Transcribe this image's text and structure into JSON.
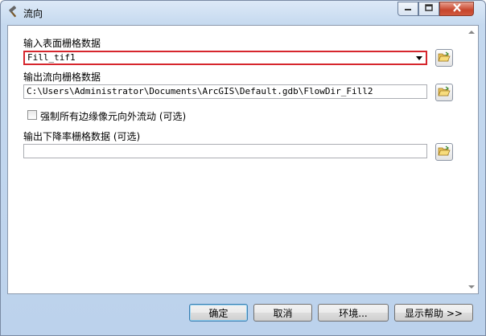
{
  "window": {
    "title": "流向",
    "icons": {
      "app": "hammer-icon",
      "minimize": "minimize-icon",
      "maximize": "maximize-icon",
      "close": "close-icon"
    }
  },
  "form": {
    "input_surface": {
      "label": "输入表面栅格数据",
      "value": "Fill_tif1",
      "browse_icon": "folder-open-icon"
    },
    "output_flow": {
      "label": "输出流向栅格数据",
      "value": "C:\\Users\\Administrator\\Documents\\ArcGIS\\Default.gdb\\FlowDir_Fill2",
      "browse_icon": "folder-open-icon"
    },
    "force_edge": {
      "label": "强制所有边缘像元向外流动 (可选)",
      "checked": false
    },
    "output_drop": {
      "label": "输出下降率栅格数据 (可选)",
      "value": "",
      "browse_icon": "folder-open-icon"
    }
  },
  "buttons": {
    "ok": "确定",
    "cancel": "取消",
    "environments": "环境...",
    "show_help": "显示帮助 >>"
  },
  "colors": {
    "highlight_border": "#d6262d",
    "default_button_border": "#3c7fb1"
  }
}
